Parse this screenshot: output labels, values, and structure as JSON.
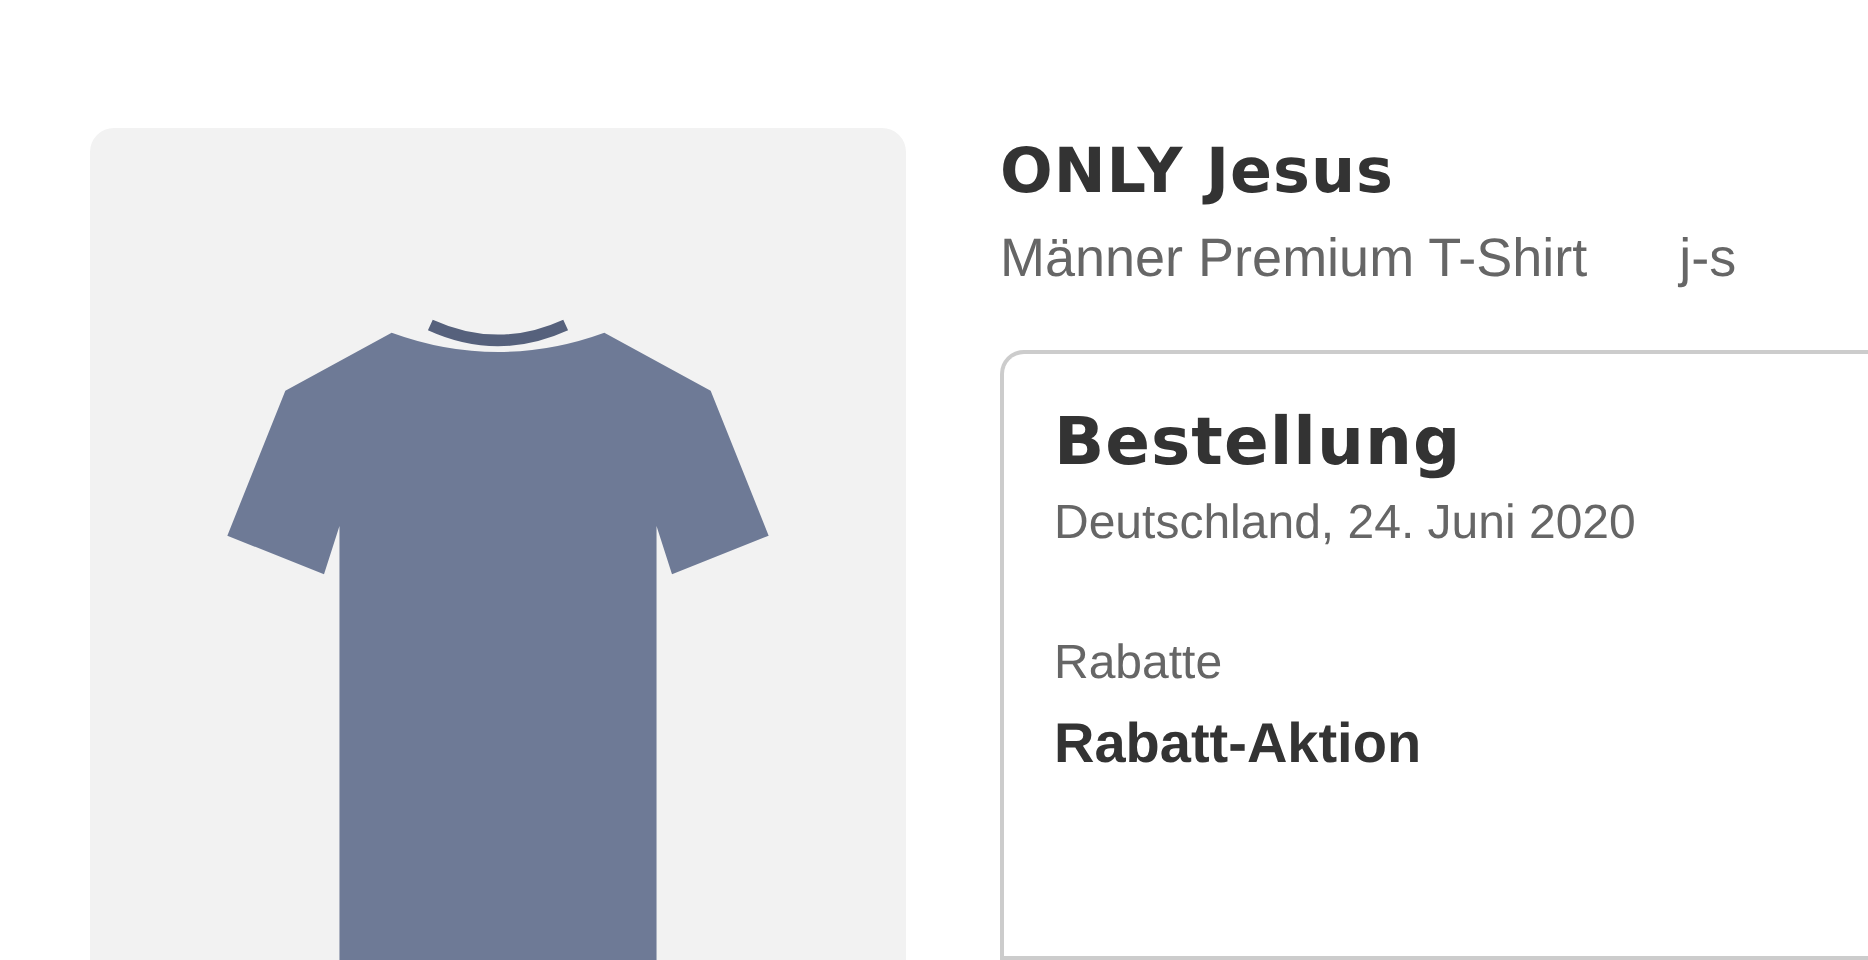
{
  "product": {
    "title": "ONLY Jesus",
    "subtitle": "Männer Premium T-Shirt",
    "seller": "j-s"
  },
  "order": {
    "heading": "Bestellung",
    "date": "Deutschland, 24. Juni 2020",
    "discount_label": "Rabatte",
    "discount_value": "Rabatt-Aktion"
  }
}
